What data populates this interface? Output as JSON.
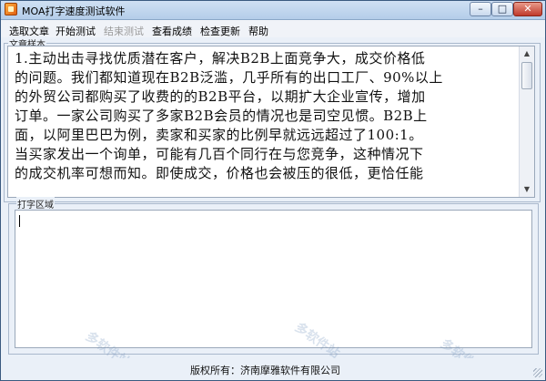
{
  "window": {
    "title": "MOA打字速度测试软件",
    "minimize_glyph": "–",
    "maximize_glyph": "□",
    "close_glyph": "✕",
    "app_icon": "moa-app-icon"
  },
  "menu": {
    "items": [
      {
        "label": "选取文章",
        "enabled": true
      },
      {
        "label": "开始测试",
        "enabled": true
      },
      {
        "label": "结束测试",
        "enabled": false
      },
      {
        "label": "查看成绩",
        "enabled": true
      },
      {
        "label": "检查更新",
        "enabled": true
      },
      {
        "label": "帮助",
        "enabled": true
      }
    ]
  },
  "sample": {
    "label": "文章样本",
    "lines": [
      "1.主动出击寻找优质潜在客户，解决B2B上面竞争大，成交价格低",
      "的问题。我们都知道现在B2B泛滥，几乎所有的出口工厂、90%以上",
      "的外贸公司都购买了收费的的B2B平台，以期扩大企业宣传，增加",
      "订单。一家公司购买了多家B2B会员的情况也是司空见惯。B2B上",
      "面，以阿里巴巴为例，卖家和买家的比例早就远远超过了100:1。",
      "当买家发出一个询单，可能有几百个同行在与您竞争，这种情况下",
      "的成交机率可想而知。即使成交，价格也会被压的很低，更恰任能"
    ]
  },
  "typing": {
    "label": "打字区域",
    "value": ""
  },
  "status": {
    "copyright": "版权所有：济南摩雅软件有限公司"
  },
  "watermark": {
    "text": "多软件站"
  },
  "colors": {
    "frame": "#3a5a80",
    "close_button": "#c0392b",
    "disabled_menu": "#9a9a9a"
  }
}
